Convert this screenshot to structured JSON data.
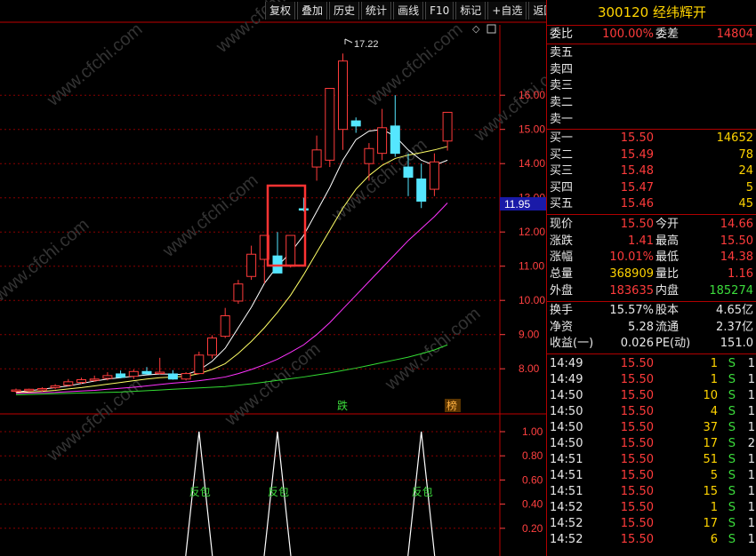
{
  "toolbar": {
    "items": [
      "复权",
      "叠加",
      "历史",
      "统计",
      "画线",
      "F10",
      "标记",
      "+自选",
      "返回"
    ]
  },
  "stock": {
    "code": "300120",
    "name": "经纬辉开"
  },
  "chart": {
    "price_axis": [
      "16.00",
      "15.00",
      "14.00",
      "13.00",
      "12.00",
      "11.00",
      "10.00",
      "9.00",
      "8.00"
    ],
    "current_price_tag": "11.95",
    "high_label": "17.22",
    "markers": {
      "die": "跌",
      "bang": "榜"
    },
    "indicator_axis": [
      "1.00",
      "0.80",
      "0.60",
      "0.40",
      "0.20"
    ],
    "indicator_label": "反包",
    "watermark": "www.cfchi.com",
    "colors": {
      "up": "#ff3b3b",
      "down": "#55e6ff",
      "ma1": "#ffffff",
      "ma2": "#ffff66",
      "ma3": "#ff33ff",
      "ma4": "#33dd33",
      "highlight_box": "#ff3333"
    }
  },
  "chart_data": {
    "type": "candlestick",
    "title": "",
    "ylim": [
      7.2,
      17.6
    ],
    "candles": [
      {
        "o": 7.36,
        "h": 7.42,
        "l": 7.3,
        "c": 7.38
      },
      {
        "o": 7.37,
        "h": 7.42,
        "l": 7.32,
        "c": 7.4
      },
      {
        "o": 7.38,
        "h": 7.46,
        "l": 7.33,
        "c": 7.42
      },
      {
        "o": 7.45,
        "h": 7.55,
        "l": 7.4,
        "c": 7.5
      },
      {
        "o": 7.52,
        "h": 7.7,
        "l": 7.48,
        "c": 7.62
      },
      {
        "o": 7.6,
        "h": 7.74,
        "l": 7.55,
        "c": 7.68
      },
      {
        "o": 7.68,
        "h": 7.8,
        "l": 7.62,
        "c": 7.7
      },
      {
        "o": 7.72,
        "h": 7.9,
        "l": 7.66,
        "c": 7.8
      },
      {
        "o": 7.85,
        "h": 7.95,
        "l": 7.72,
        "c": 7.75
      },
      {
        "o": 7.78,
        "h": 7.98,
        "l": 7.7,
        "c": 7.92
      },
      {
        "o": 7.92,
        "h": 8.05,
        "l": 7.85,
        "c": 7.85
      },
      {
        "o": 7.9,
        "h": 8.32,
        "l": 7.84,
        "c": 7.9
      },
      {
        "o": 7.85,
        "h": 7.96,
        "l": 7.68,
        "c": 7.7
      },
      {
        "o": 7.7,
        "h": 7.9,
        "l": 7.66,
        "c": 7.86
      },
      {
        "o": 7.86,
        "h": 8.5,
        "l": 7.84,
        "c": 8.4
      },
      {
        "o": 8.4,
        "h": 8.98,
        "l": 8.3,
        "c": 8.9
      },
      {
        "o": 8.95,
        "h": 9.78,
        "l": 8.9,
        "c": 9.55
      },
      {
        "o": 9.98,
        "h": 10.6,
        "l": 9.9,
        "c": 10.48
      },
      {
        "o": 10.7,
        "h": 11.6,
        "l": 10.6,
        "c": 11.35
      },
      {
        "o": 11.2,
        "h": 11.8,
        "l": 10.5,
        "c": 11.9
      },
      {
        "o": 11.3,
        "h": 12.0,
        "l": 10.9,
        "c": 10.8
      },
      {
        "o": 11.0,
        "h": 11.8,
        "l": 10.96,
        "c": 11.9
      },
      {
        "o": 12.68,
        "h": 13.0,
        "l": 12.6,
        "c": 12.66
      },
      {
        "o": 13.9,
        "h": 14.82,
        "l": 13.5,
        "c": 14.4
      },
      {
        "o": 14.1,
        "h": 15.08,
        "l": 13.9,
        "c": 16.2
      },
      {
        "o": 15.0,
        "h": 17.22,
        "l": 14.4,
        "c": 17.0
      },
      {
        "o": 15.25,
        "h": 15.35,
        "l": 14.9,
        "c": 15.1
      },
      {
        "o": 14.0,
        "h": 14.6,
        "l": 13.5,
        "c": 14.44
      },
      {
        "o": 14.3,
        "h": 15.6,
        "l": 14.1,
        "c": 15.05
      },
      {
        "o": 15.1,
        "h": 16.0,
        "l": 14.2,
        "c": 14.3
      },
      {
        "o": 13.9,
        "h": 14.3,
        "l": 13.05,
        "c": 13.6
      },
      {
        "o": 13.55,
        "h": 14.0,
        "l": 12.7,
        "c": 12.9
      },
      {
        "o": 13.25,
        "h": 14.3,
        "l": 13.05,
        "c": 14.05
      },
      {
        "o": 14.66,
        "h": 15.5,
        "l": 14.38,
        "c": 15.5
      }
    ],
    "ma_lines": [
      {
        "name": "MA5",
        "values": [
          7.32,
          7.36,
          7.4,
          7.45,
          7.5,
          7.57,
          7.64,
          7.7,
          7.74,
          7.78,
          7.82,
          7.85,
          7.84,
          7.83,
          7.96,
          8.22,
          8.6,
          9.2,
          9.8,
          10.5,
          11.0,
          11.4,
          11.9,
          12.6,
          13.3,
          14.1,
          14.7,
          14.95,
          15.0,
          14.8,
          14.4,
          14.1,
          13.95,
          14.1
        ]
      },
      {
        "name": "MA10",
        "values": [
          7.3,
          7.32,
          7.34,
          7.37,
          7.41,
          7.45,
          7.5,
          7.55,
          7.6,
          7.65,
          7.7,
          7.74,
          7.76,
          7.78,
          7.86,
          7.98,
          8.15,
          8.45,
          8.8,
          9.2,
          9.65,
          10.15,
          10.75,
          11.4,
          12.05,
          12.7,
          13.25,
          13.65,
          13.95,
          14.15,
          14.25,
          14.32,
          14.4,
          14.5
        ]
      },
      {
        "name": "MA20",
        "values": [
          7.28,
          7.29,
          7.3,
          7.31,
          7.33,
          7.35,
          7.37,
          7.4,
          7.43,
          7.46,
          7.5,
          7.54,
          7.58,
          7.61,
          7.65,
          7.7,
          7.76,
          7.86,
          7.98,
          8.12,
          8.28,
          8.48,
          8.7,
          9.0,
          9.35,
          9.75,
          10.15,
          10.55,
          10.95,
          11.35,
          11.75,
          12.1,
          12.45,
          12.85
        ]
      },
      {
        "name": "MA60",
        "values": [
          7.24,
          7.25,
          7.26,
          7.27,
          7.28,
          7.29,
          7.3,
          7.31,
          7.32,
          7.34,
          7.36,
          7.38,
          7.4,
          7.42,
          7.44,
          7.46,
          7.48,
          7.52,
          7.56,
          7.61,
          7.66,
          7.71,
          7.76,
          7.82,
          7.88,
          7.95,
          8.02,
          8.1,
          8.18,
          8.26,
          8.34,
          8.44,
          8.55,
          8.7
        ]
      }
    ],
    "indicator": {
      "ylim": [
        0,
        1.1
      ],
      "spikes_at": [
        14,
        20,
        31
      ],
      "label": "反包"
    }
  },
  "quote": {
    "weibi_label": "委比",
    "weibi_value": "100.00%",
    "weicha_label": "委差",
    "weicha_value": "14804",
    "sells": [
      {
        "label": "卖五"
      },
      {
        "label": "卖四"
      },
      {
        "label": "卖三"
      },
      {
        "label": "卖二"
      },
      {
        "label": "卖一"
      }
    ],
    "buys": [
      {
        "label": "买一",
        "price": "15.50",
        "vol": "14652"
      },
      {
        "label": "买二",
        "price": "15.49",
        "vol": "78"
      },
      {
        "label": "买三",
        "price": "15.48",
        "vol": "24"
      },
      {
        "label": "买四",
        "price": "15.47",
        "vol": "5"
      },
      {
        "label": "买五",
        "price": "15.46",
        "vol": "45"
      }
    ],
    "stats": [
      {
        "l1": "现价",
        "v1": "15.50",
        "l2": "今开",
        "v2": "14.66"
      },
      {
        "l1": "涨跌",
        "v1": "1.41",
        "l2": "最高",
        "v2": "15.50"
      },
      {
        "l1": "涨幅",
        "v1": "10.01%",
        "l2": "最低",
        "v2": "14.38"
      },
      {
        "l1": "总量",
        "v1": "368909",
        "l2": "量比",
        "v2": "1.16"
      },
      {
        "l1": "外盘",
        "v1": "183635",
        "l2": "内盘",
        "v2": "185274"
      }
    ],
    "fin": [
      {
        "l1": "换手",
        "v1": "15.57%",
        "l2": "股本",
        "v2": "4.65亿"
      },
      {
        "l1": "净资",
        "v1": "5.28",
        "l2": "流通",
        "v2": "2.37亿"
      },
      {
        "l1": "收益(一)",
        "v1": "0.026",
        "l2": "PE(动)",
        "v2": "151.0"
      }
    ]
  },
  "ticks": [
    {
      "time": "14:49",
      "price": "15.50",
      "vol": "1",
      "side": "S",
      "n": "1"
    },
    {
      "time": "14:49",
      "price": "15.50",
      "vol": "1",
      "side": "S",
      "n": "1"
    },
    {
      "time": "14:50",
      "price": "15.50",
      "vol": "10",
      "side": "S",
      "n": "1"
    },
    {
      "time": "14:50",
      "price": "15.50",
      "vol": "4",
      "side": "S",
      "n": "1"
    },
    {
      "time": "14:50",
      "price": "15.50",
      "vol": "37",
      "side": "S",
      "n": "1"
    },
    {
      "time": "14:50",
      "price": "15.50",
      "vol": "17",
      "side": "S",
      "n": "2"
    },
    {
      "time": "14:51",
      "price": "15.50",
      "vol": "51",
      "side": "S",
      "n": "1"
    },
    {
      "time": "14:51",
      "price": "15.50",
      "vol": "5",
      "side": "S",
      "n": "1"
    },
    {
      "time": "14:51",
      "price": "15.50",
      "vol": "15",
      "side": "S",
      "n": "1"
    },
    {
      "time": "14:52",
      "price": "15.50",
      "vol": "1",
      "side": "S",
      "n": "1"
    },
    {
      "time": "14:52",
      "price": "15.50",
      "vol": "17",
      "side": "S",
      "n": "1"
    },
    {
      "time": "14:52",
      "price": "15.50",
      "vol": "6",
      "side": "S",
      "n": "1"
    }
  ]
}
